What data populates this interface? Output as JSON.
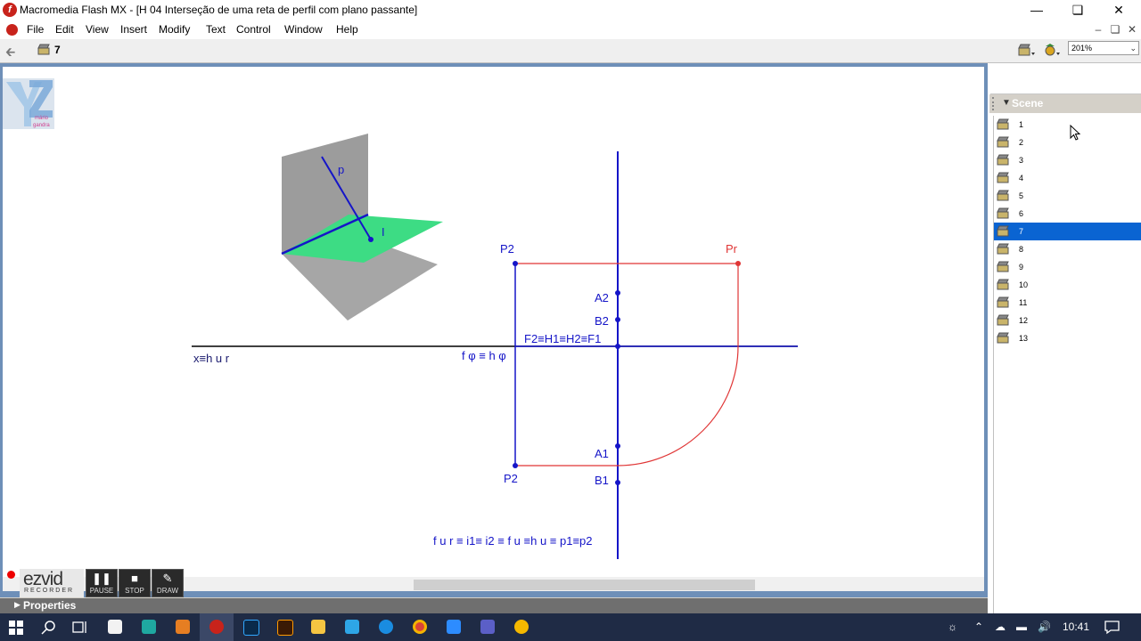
{
  "window": {
    "title": "Macromedia Flash MX - [H 04 Interseção de uma reta de perfil com plano passante]",
    "minimize_icon": "minimize-icon",
    "restore_icon": "restore-icon",
    "close_icon": "close-icon"
  },
  "menu": {
    "items": [
      "File",
      "Edit",
      "View",
      "Insert",
      "Modify",
      "Text",
      "Control",
      "Window",
      "Help"
    ]
  },
  "toolbar": {
    "current_scene": "7",
    "zoom": "201%"
  },
  "drawing": {
    "labels": {
      "p": "p",
      "i": "I",
      "p2_top": "P2",
      "pr": "Pr",
      "a2": "A2",
      "b2": "B2",
      "f2h1": "F2≡H1≡H2≡F1",
      "xhur": "x≡h u r",
      "fphi": "f φ ≡ h φ",
      "a1": "A1",
      "p2_bottom": "P2",
      "b1": "B1",
      "bottom_eq": "f u r ≡ i1≡ i2 ≡ f u ≡h u ≡ p1≡p2"
    },
    "colors": {
      "blue": "#1515c8",
      "red": "#e03535",
      "green": "#3ddc84",
      "gray": "#a0a0a0"
    }
  },
  "scene_panel": {
    "title": "Scene",
    "scenes": [
      "1",
      "2",
      "3",
      "4",
      "5",
      "6",
      "7",
      "8",
      "9",
      "10",
      "11",
      "12",
      "13"
    ],
    "selected": "7"
  },
  "properties": {
    "label": "Properties"
  },
  "ezvid": {
    "brand": "ezvid",
    "sub": "RECORDER",
    "pause": "PAUSE",
    "stop": "STOP",
    "draw": "DRAW"
  },
  "logo": {
    "text1": "mário",
    "text2": "gandra"
  },
  "taskbar": {
    "time": "10:41"
  }
}
